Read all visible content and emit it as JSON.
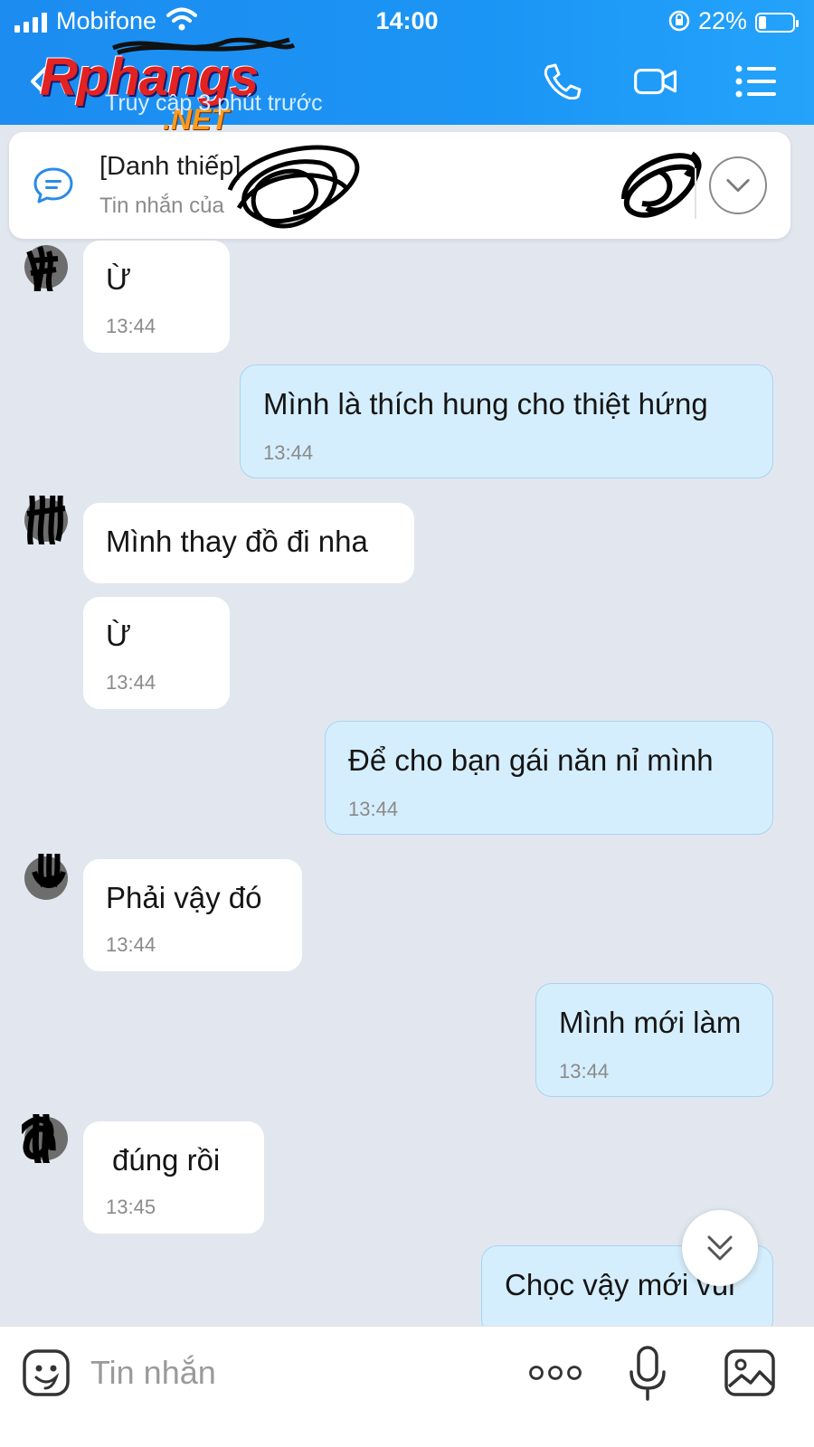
{
  "status_bar": {
    "carrier": "Mobifone",
    "time": "14:00",
    "battery_percent": "22%",
    "battery_level": 0.22
  },
  "header": {
    "watermark_main": "Rphangs",
    "watermark_sub": ".NET",
    "last_seen": "Truy cập 3 phút trước"
  },
  "pinned": {
    "title": "[Danh thiếp]",
    "subtitle": "Tin nhắn của"
  },
  "messages": [
    {
      "side": "in",
      "text": "Ừ",
      "time": "13:44"
    },
    {
      "side": "out",
      "text": "Mình là thích hung cho thiệt hứng",
      "time": "13:44"
    },
    {
      "side": "in",
      "text": "Mình thay đồ đi nha",
      "time": ""
    },
    {
      "side": "in",
      "text": "Ừ",
      "time": "13:44"
    },
    {
      "side": "out",
      "text": "Để cho bạn gái năn nỉ mình",
      "time": "13:44"
    },
    {
      "side": "in",
      "text": "Phải vậy đó",
      "time": "13:44"
    },
    {
      "side": "out",
      "text": "Mình mới làm",
      "time": "13:44"
    },
    {
      "side": "in",
      "text": "đúng rồi",
      "time": "13:45"
    },
    {
      "side": "out",
      "text": "Chọc vậy mới vui",
      "time": ""
    }
  ],
  "composer": {
    "placeholder": "Tin nhắn"
  },
  "colors": {
    "header_blue": "#1b95f5",
    "outgoing_bubble": "#d5eefd",
    "incoming_bubble": "#ffffff",
    "chat_background": "#e2e7ef"
  }
}
